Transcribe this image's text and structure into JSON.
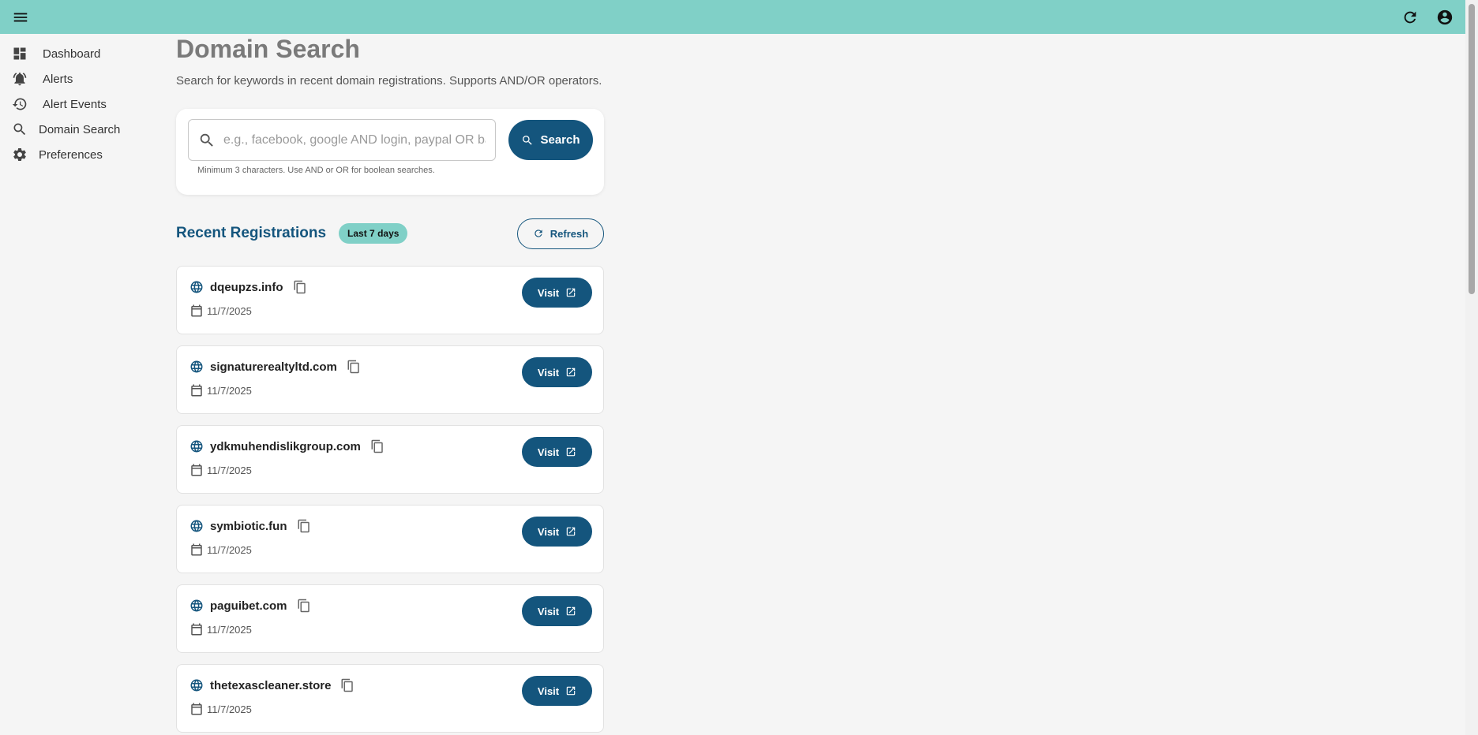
{
  "sidebar": {
    "items": [
      {
        "label": "Dashboard",
        "icon": "dashboard-icon"
      },
      {
        "label": "Alerts",
        "icon": "bell-icon"
      },
      {
        "label": "Alert Events",
        "icon": "history-icon"
      },
      {
        "label": "Domain Search",
        "icon": "search-icon"
      },
      {
        "label": "Preferences",
        "icon": "gear-icon"
      }
    ]
  },
  "main": {
    "title": "Domain Search",
    "description": "Search for keywords in recent domain registrations. Supports AND/OR operators.",
    "search": {
      "placeholder": "e.g., facebook, google AND login, paypal OR bank",
      "value": "",
      "button_label": "Search",
      "hint": "Minimum 3 characters. Use AND or OR for boolean searches."
    },
    "recent": {
      "title": "Recent Registrations",
      "badge": "Last 7 days",
      "refresh_label": "Refresh",
      "visit_label": "Visit",
      "domains": [
        {
          "name": "dqeupzs.info",
          "date": "11/7/2025"
        },
        {
          "name": "signaturerealtyltd.com",
          "date": "11/7/2025"
        },
        {
          "name": "ydkmuhendislikgroup.com",
          "date": "11/7/2025"
        },
        {
          "name": "symbiotic.fun",
          "date": "11/7/2025"
        },
        {
          "name": "paguibet.com",
          "date": "11/7/2025"
        },
        {
          "name": "thetexascleaner.store",
          "date": "11/7/2025"
        }
      ]
    }
  },
  "colors": {
    "topbar": "#80d0c7",
    "primary": "#14557d",
    "badge": "#80d0c7"
  }
}
